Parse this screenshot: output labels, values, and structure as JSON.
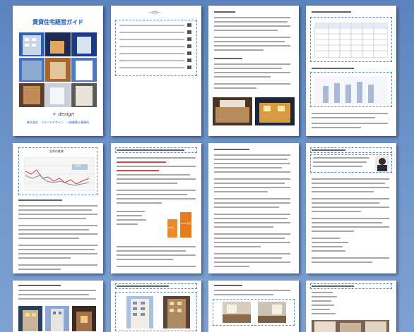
{
  "cover": {
    "title": "賃貸住宅経営ガイド",
    "design_label": "+ design",
    "footer_company": "株式会社　ブランドデザイン　一級建築士事務所"
  },
  "toc": {
    "heading": "―目次―"
  },
  "chart_page": {
    "heading": "金利の推移",
    "note": "39%"
  },
  "bar_chart_page": {
    "bar1": "XXX円",
    "bar2": "X,XXX万円"
  },
  "colors": {
    "background": "#6f95cb",
    "accent": "#2f6ec2",
    "dashed": "#5a8ad2"
  }
}
